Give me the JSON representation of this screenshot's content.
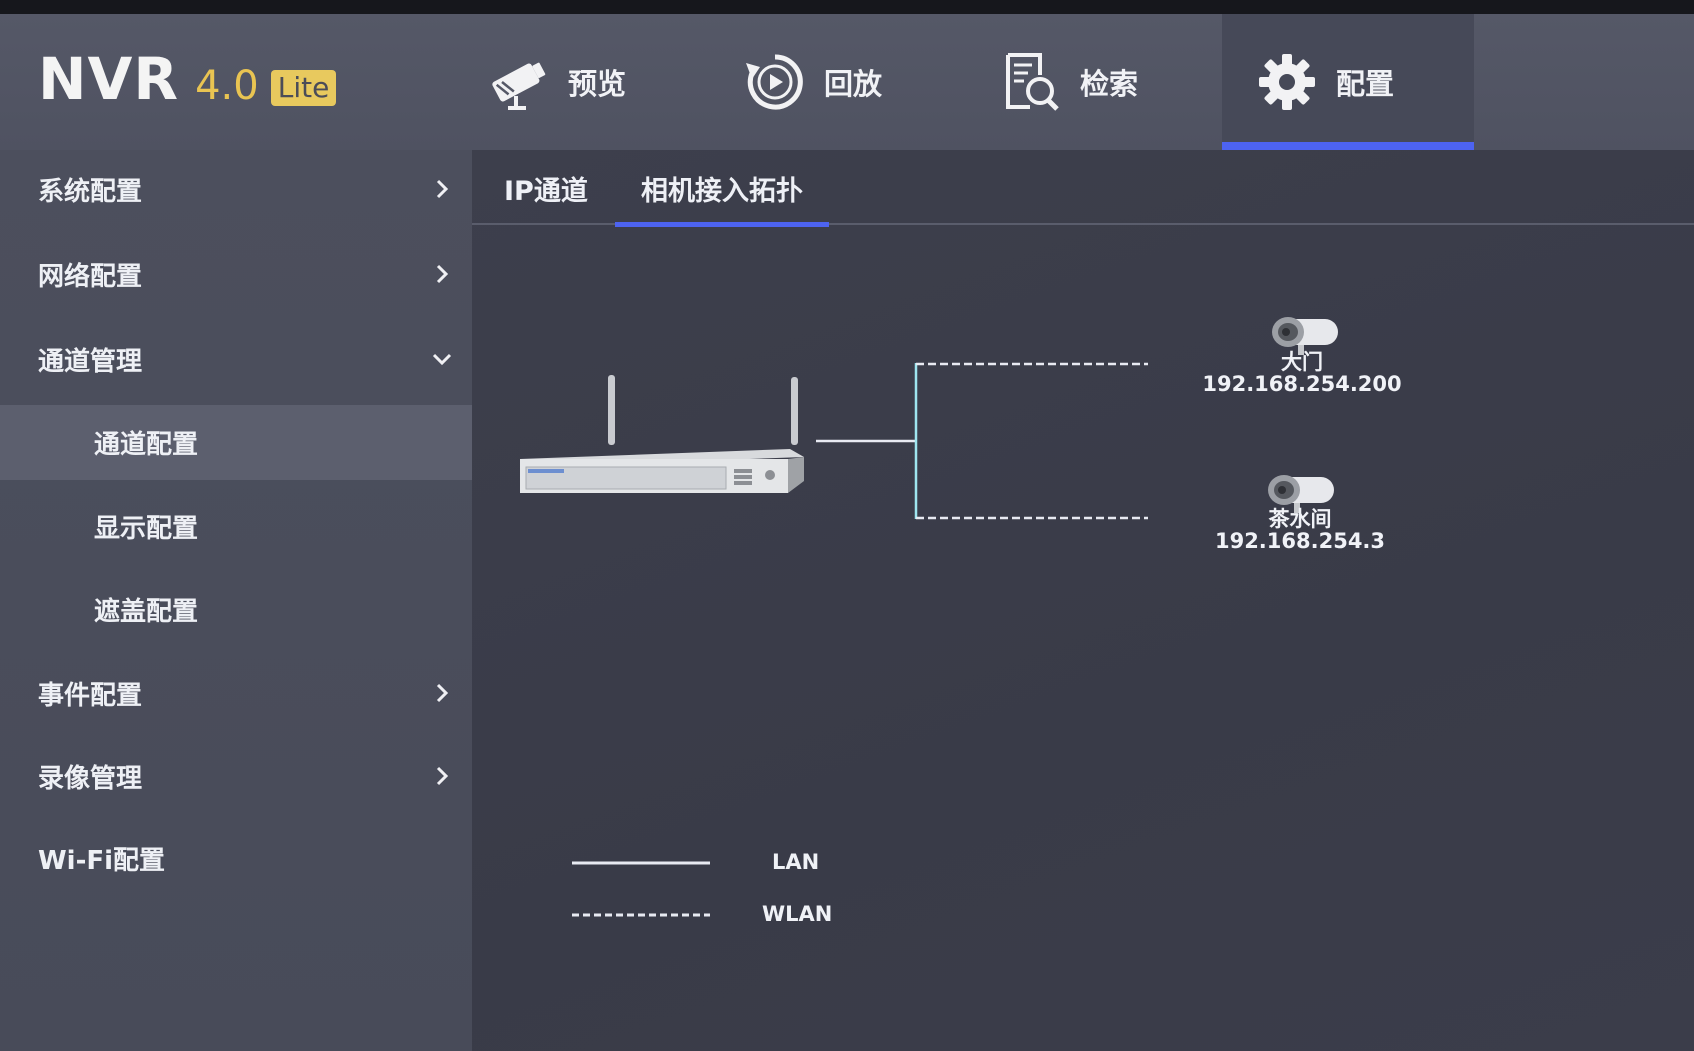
{
  "app": {
    "logo_main": "NVR",
    "logo_version": "4.0",
    "logo_edition": "Lite"
  },
  "nav": [
    {
      "label": "预览",
      "icon": "camera-icon"
    },
    {
      "label": "回放",
      "icon": "playback-icon"
    },
    {
      "label": "检索",
      "icon": "search-icon"
    },
    {
      "label": "配置",
      "icon": "gear-icon",
      "active": true
    }
  ],
  "sidebar": {
    "items": [
      {
        "label": "系统配置",
        "level": 1,
        "chevron": "right"
      },
      {
        "label": "网络配置",
        "level": 1,
        "chevron": "right"
      },
      {
        "label": "通道管理",
        "level": 1,
        "chevron": "down"
      },
      {
        "label": "通道配置",
        "level": 2,
        "selected": true
      },
      {
        "label": "显示配置",
        "level": 2
      },
      {
        "label": "遮盖配置",
        "level": 2
      },
      {
        "label": "事件配置",
        "level": 1,
        "chevron": "right"
      },
      {
        "label": "录像管理",
        "level": 1,
        "chevron": "right"
      },
      {
        "label": "Wi-Fi配置",
        "level": 1
      }
    ]
  },
  "tabs": [
    {
      "label": "IP通道"
    },
    {
      "label": "相机接入拓扑",
      "active": true
    }
  ],
  "topology": {
    "cameras": [
      {
        "name": "大门",
        "ip": "192.168.254.200",
        "link": "WLAN"
      },
      {
        "name": "茶水间",
        "ip": "192.168.254.3",
        "link": "WLAN"
      }
    ],
    "legend": [
      {
        "label": "LAN",
        "style": "solid"
      },
      {
        "label": "WLAN",
        "style": "dashed"
      }
    ]
  },
  "colors": {
    "accent": "#4d63f0",
    "logo_gold": "#e9c452",
    "lan_line": "#e8eaf2",
    "wlan_line": "#e8eaf2",
    "trunk_line": "#9fe6f0"
  }
}
